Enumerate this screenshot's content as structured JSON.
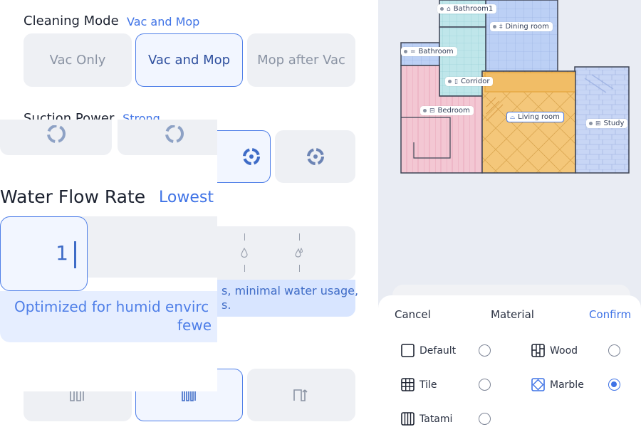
{
  "cleaning_mode": {
    "title": "Cleaning Mode",
    "value": "Vac and Mop",
    "options": [
      "Vac Only",
      "Vac and Mop",
      "Mop after Vac"
    ],
    "selected_index": 1
  },
  "suction_power": {
    "title_partial": "Suction Power",
    "value_partial": "Strong"
  },
  "water_flow": {
    "title": "Water Flow Rate",
    "value": "Lowest",
    "selected_level": "1",
    "description_front": "Optimized for humid envirc",
    "description_front_line2": "fewe",
    "description_back": "s, minimal water usage,",
    "description_back_line2": "s."
  },
  "map": {
    "rooms": [
      {
        "name": "Bathroom1",
        "icon": "toilet-icon"
      },
      {
        "name": "Dining room",
        "icon": "dining-icon"
      },
      {
        "name": "Bathroom",
        "icon": "bath-icon"
      },
      {
        "name": "Corridor",
        "icon": "corridor-icon"
      },
      {
        "name": "Bedroom",
        "icon": "bed-icon"
      },
      {
        "name": "Living room",
        "icon": "sofa-icon"
      },
      {
        "name": "Study",
        "icon": "study-icon"
      }
    ]
  },
  "material_sheet": {
    "cancel": "Cancel",
    "title": "Material",
    "confirm": "Confirm",
    "options": [
      {
        "label": "Default",
        "icon": "default-square-icon",
        "selected": false
      },
      {
        "label": "Wood",
        "icon": "wood-icon",
        "selected": false
      },
      {
        "label": "Tile",
        "icon": "tile-grid-icon",
        "selected": false
      },
      {
        "label": "Marble",
        "icon": "marble-diamond-icon",
        "selected": true
      },
      {
        "label": "Tatami",
        "icon": "tatami-icon",
        "selected": false
      }
    ]
  },
  "colors": {
    "accent": "#3f73e6",
    "bedroom": "#f3c7d3",
    "living": "#f4c77a",
    "bath": "#bfe6ea",
    "blue_rooms": "#bcd0f5"
  }
}
